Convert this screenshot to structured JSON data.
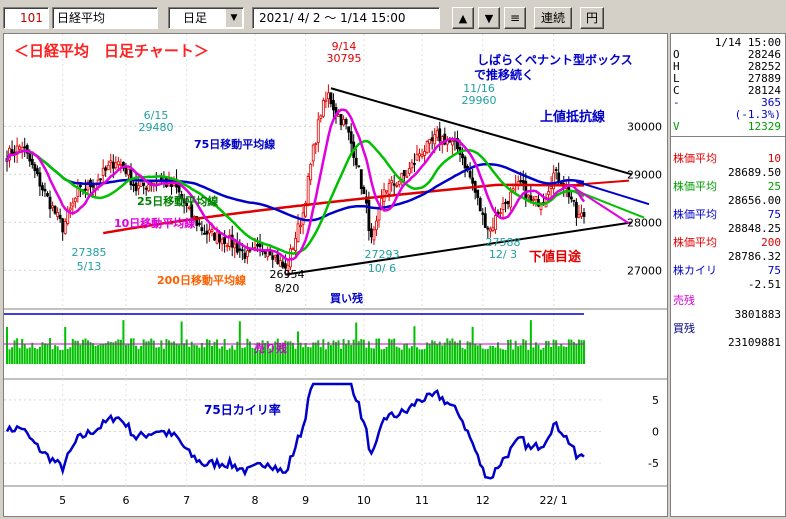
{
  "toolbar": {
    "code": "101",
    "name": "日経平均",
    "period": "日足",
    "range": "2021/ 4/ 2 ～ 1/14 15:00",
    "up_icon": "triangle-up-icon",
    "down_icon": "triangle-down-icon",
    "menu_icon": "menu-lines-icon",
    "continuous_label": "連続",
    "yen_label": "円"
  },
  "annotations": {
    "title": "＜日経平均　日足チャート＞",
    "pennant": "しばらくペナント型ボックス",
    "pennant2": "で推移続く",
    "resistance": "上値抵抗線",
    "support": "下値目途",
    "ma75": "75日移動平均線",
    "ma25": "25日移動平均線",
    "ma10": "10日移動平均線",
    "ma200": "200日移動平均線",
    "buy_rem": "買い残",
    "sell_rem": "売り残",
    "kairi": "75日カイリ率"
  },
  "callouts": [
    {
      "date": "9/14",
      "value": "30795"
    },
    {
      "date": "6/15",
      "value": "29480"
    },
    {
      "date": "11/16",
      "value": "29960"
    },
    {
      "date": "5/13",
      "value": "27385"
    },
    {
      "date": "10/ 6",
      "value": "27293"
    },
    {
      "date": "12/ 3",
      "value": "27588"
    },
    {
      "date": "8/20",
      "value": "26954"
    }
  ],
  "chart_data": {
    "type": "line",
    "price_axis": {
      "ticks": [
        30000,
        29000,
        28000,
        27000
      ],
      "ylim": [
        26300,
        31300
      ]
    },
    "kairi_axis": {
      "ticks": [
        5,
        0,
        -5
      ],
      "ylim": [
        -7.5,
        7.5
      ]
    },
    "x_month_labels": [
      "5",
      "6",
      "7",
      "8",
      "9",
      "10",
      "11",
      "12",
      "22/ 1"
    ],
    "x_month_index": [
      22,
      47,
      71,
      98,
      118,
      141,
      164,
      188,
      216
    ],
    "n_days": 229,
    "close_anchors": [
      [
        0,
        29400
      ],
      [
        6,
        29600
      ],
      [
        15,
        28600
      ],
      [
        22,
        27900
      ],
      [
        28,
        28600
      ],
      [
        36,
        28900
      ],
      [
        43,
        29300
      ],
      [
        47,
        29100
      ],
      [
        51,
        28700
      ],
      [
        60,
        28900
      ],
      [
        67,
        28700
      ],
      [
        72,
        28200
      ],
      [
        78,
        27800
      ],
      [
        84,
        27700
      ],
      [
        88,
        27600
      ],
      [
        95,
        27300
      ],
      [
        103,
        27500
      ],
      [
        110,
        27000
      ],
      [
        114,
        27700
      ],
      [
        117,
        28200
      ],
      [
        121,
        29500
      ],
      [
        124,
        30300
      ],
      [
        127,
        30650
      ],
      [
        130,
        30300
      ],
      [
        134,
        30000
      ],
      [
        138,
        29300
      ],
      [
        142,
        28300
      ],
      [
        144,
        27600
      ],
      [
        146,
        27900
      ],
      [
        149,
        28700
      ],
      [
        153,
        28800
      ],
      [
        158,
        29000
      ],
      [
        163,
        29450
      ],
      [
        167,
        29600
      ],
      [
        170,
        29800
      ],
      [
        174,
        29700
      ],
      [
        179,
        29500
      ],
      [
        184,
        28800
      ],
      [
        188,
        28100
      ],
      [
        191,
        27850
      ],
      [
        194,
        28200
      ],
      [
        198,
        28500
      ],
      [
        203,
        28800
      ],
      [
        207,
        28400
      ],
      [
        212,
        28500
      ],
      [
        216,
        29000
      ],
      [
        219,
        28900
      ],
      [
        223,
        28500
      ],
      [
        225,
        28124
      ]
    ],
    "series": [
      {
        "name": "株価平均 10",
        "value": 28689.5,
        "color": "#e000e0"
      },
      {
        "name": "株価平均 25",
        "value": 28656.0,
        "color": "#00c000"
      },
      {
        "name": "株価平均 75",
        "value": 28848.25,
        "color": "#0000c8"
      },
      {
        "name": "株価平均 200",
        "value": 28786.32,
        "color": "#e00000"
      }
    ],
    "volume": {
      "buy_remaining": 3801883,
      "sell_remaining": 23109881
    }
  },
  "info": {
    "datetime": "1/14 15:00",
    "rows": [
      {
        "k": "O",
        "v": "28246"
      },
      {
        "k": "H",
        "v": "28252"
      },
      {
        "k": "L",
        "v": "27889"
      },
      {
        "k": "C",
        "v": "28124"
      },
      {
        "k": "-",
        "v": "365"
      },
      {
        "k": "",
        "v": "(-1.3%)"
      },
      {
        "k": "V",
        "v": "12329"
      }
    ],
    "ma_rows": [
      {
        "label": "株価平均",
        "period": "10",
        "value": "28689.50",
        "color": "#e000e0"
      },
      {
        "label": "株価平均",
        "period": "25",
        "value": "28656.00",
        "color": "#00c000"
      },
      {
        "label": "株価平均",
        "period": "75",
        "value": "28848.25",
        "color": "#0000c8"
      },
      {
        "label": "株価平均",
        "period": "200",
        "value": "28786.32",
        "color": "#e00000"
      }
    ],
    "kairi_label": "株カイリ",
    "kairi_period": "75",
    "kairi_value": "-2.51",
    "sell_label": "売残",
    "sell_value": "3801883",
    "buy_label": "買残",
    "buy_value": "23109881"
  }
}
